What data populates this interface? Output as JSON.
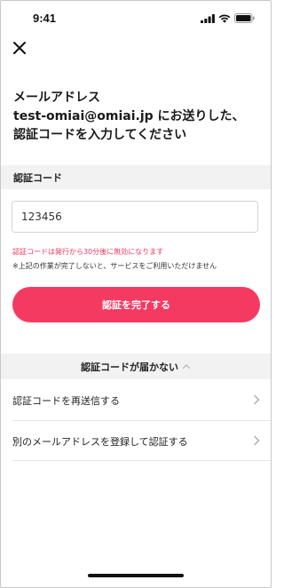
{
  "status_bar": {
    "time": "9:41",
    "icons": [
      "signal-icon",
      "wifi-icon",
      "battery-icon"
    ]
  },
  "header": {
    "close_icon": "close-icon"
  },
  "heading": {
    "line1": "メールアドレス",
    "line2": "test-omiai@omiai.jp にお送りした、",
    "line3": "認証コードを入力してください"
  },
  "form": {
    "section_label": "認証コード",
    "code_value": "123456",
    "note_red": "認証コードは発行から30分後に無効になります",
    "note_gray": "※上記の作業が完了しないと、サービスをご利用いただけません",
    "submit_label": "認証を完了する"
  },
  "help": {
    "title": "認証コードが届かない",
    "expanded": true,
    "items": [
      {
        "label": "認証コードを再送信する"
      },
      {
        "label": "別のメールアドレスを登録して認証する"
      }
    ]
  },
  "colors": {
    "accent": "#f53a61",
    "warning_text": "#ec3a62",
    "section_bg": "#f2f2f2"
  }
}
